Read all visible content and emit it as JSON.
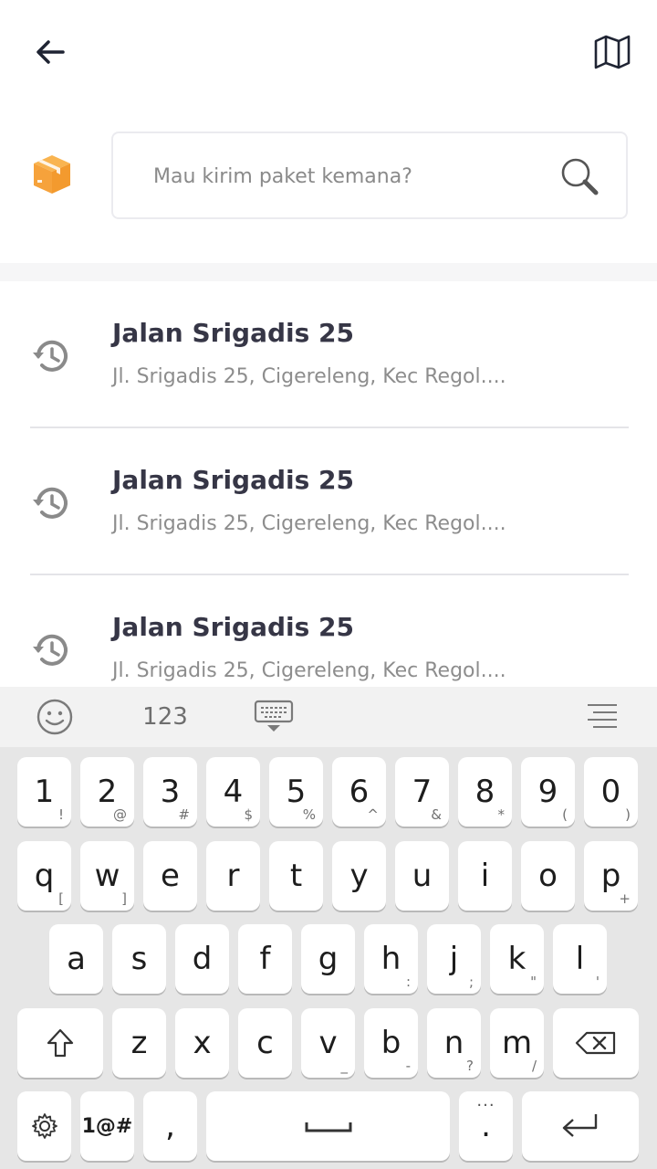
{
  "header": {
    "back_icon": "arrow-left-icon",
    "map_icon": "map-icon"
  },
  "search": {
    "leading_icon": "package-box-icon",
    "placeholder": "Mau kirim paket kemana?",
    "trailing_icon": "search-icon",
    "accent_color": "#F6A23B"
  },
  "history": [
    {
      "title": "Jalan Srigadis 25",
      "subtitle": "Jl. Srigadis 25, Cigereleng, Kec Regol...."
    },
    {
      "title": "Jalan Srigadis 25",
      "subtitle": "Jl. Srigadis 25, Cigereleng, Kec Regol...."
    },
    {
      "title": "Jalan Srigadis 25",
      "subtitle": "Jl. Srigadis 25, Cigereleng, Kec Regol...."
    }
  ],
  "keyboard": {
    "toolbar": {
      "emoji_icon": "emoji-icon",
      "numbers_label": "123",
      "hide_icon": "keyboard-hide-icon",
      "menu_icon": "menu-icon"
    },
    "row1": [
      {
        "main": "1",
        "sub": "!"
      },
      {
        "main": "2",
        "sub": "@"
      },
      {
        "main": "3",
        "sub": "#"
      },
      {
        "main": "4",
        "sub": "$"
      },
      {
        "main": "5",
        "sub": "%"
      },
      {
        "main": "6",
        "sub": "^"
      },
      {
        "main": "7",
        "sub": "&"
      },
      {
        "main": "8",
        "sub": "*"
      },
      {
        "main": "9",
        "sub": "("
      },
      {
        "main": "0",
        "sub": ")"
      }
    ],
    "row2": [
      {
        "main": "q",
        "sub": "["
      },
      {
        "main": "w",
        "sub": "]"
      },
      {
        "main": "e",
        "sub": ""
      },
      {
        "main": "r",
        "sub": ""
      },
      {
        "main": "t",
        "sub": ""
      },
      {
        "main": "y",
        "sub": ""
      },
      {
        "main": "u",
        "sub": ""
      },
      {
        "main": "i",
        "sub": ""
      },
      {
        "main": "o",
        "sub": ""
      },
      {
        "main": "p",
        "sub": "+"
      }
    ],
    "row3": [
      {
        "main": "a",
        "sub": ""
      },
      {
        "main": "s",
        "sub": ""
      },
      {
        "main": "d",
        "sub": ""
      },
      {
        "main": "f",
        "sub": ""
      },
      {
        "main": "g",
        "sub": ""
      },
      {
        "main": "h",
        "sub": ":"
      },
      {
        "main": "j",
        "sub": ";"
      },
      {
        "main": "k",
        "sub": "\""
      },
      {
        "main": "l",
        "sub": "'"
      }
    ],
    "row4": [
      {
        "main": "z",
        "sub": ""
      },
      {
        "main": "x",
        "sub": ""
      },
      {
        "main": "c",
        "sub": ""
      },
      {
        "main": "v",
        "sub": "_"
      },
      {
        "main": "b",
        "sub": "-"
      },
      {
        "main": "n",
        "sub": "?"
      },
      {
        "main": "m",
        "sub": "/"
      }
    ],
    "row5": {
      "symbols_label": "1@#",
      "comma": ",",
      "period": ".",
      "period_sub": "..."
    }
  }
}
